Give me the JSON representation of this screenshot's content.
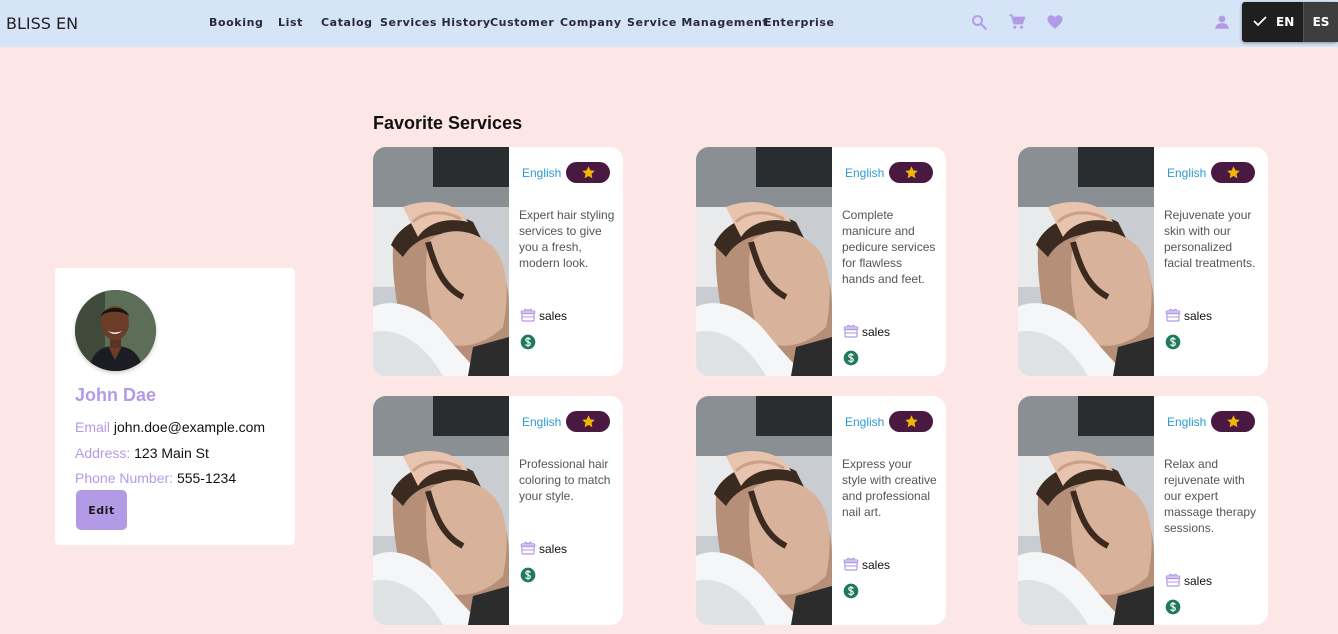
{
  "header": {
    "brand": "BLISS EN",
    "nav": [
      "Booking",
      "List",
      "Catalog",
      "Services History",
      "Customer",
      "Company",
      "Service Management",
      "Enterprise"
    ],
    "icons": [
      "search-icon",
      "cart-icon",
      "heart-icon",
      "account-icon"
    ],
    "lang_options": [
      "EN",
      "ES"
    ],
    "lang_selected": "EN"
  },
  "profile": {
    "name": "John Dae",
    "email_label": "Email",
    "email": "john.doe@example.com",
    "address_label": "Address:",
    "address": "123 Main St",
    "phone_label": "Phone Number:",
    "phone": "555-1234",
    "edit_label": "Edit"
  },
  "favorites": {
    "title": "Favorite Services",
    "cards": [
      {
        "language": "English",
        "description": "Expert hair styling services to give you a fresh, modern look.",
        "category": "sales"
      },
      {
        "language": "English",
        "description": "Complete manicure and pedicure services for flawless hands and feet.",
        "category": "sales"
      },
      {
        "language": "English",
        "description": "Rejuvenate your skin with our personalized facial treatments.",
        "category": "sales"
      },
      {
        "language": "English",
        "description": "Professional hair coloring to match your style.",
        "category": "sales"
      },
      {
        "language": "English",
        "description": "Express your style with creative and professional nail art.",
        "category": "sales"
      },
      {
        "language": "English",
        "description": "Relax and rejuvenate with our expert massage therapy sessions.",
        "category": "sales"
      }
    ]
  },
  "colors": {
    "accent": "#b39ae6",
    "header_bg": "#d6e4f7",
    "page_bg": "#fce6e6",
    "favorite_pill": "#4a1942",
    "star": "#f2b705",
    "language_text": "#2b9bd6",
    "price_icon": "#1f7a5c"
  }
}
